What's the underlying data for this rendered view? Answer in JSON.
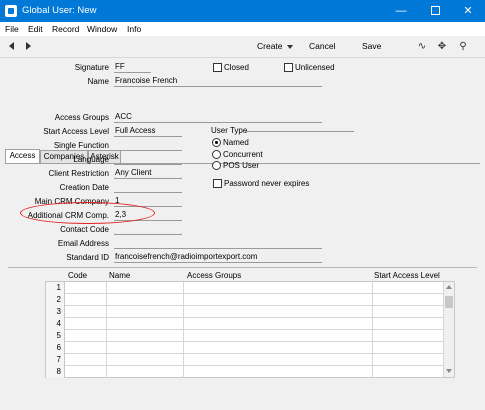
{
  "window": {
    "title": "Global User: New"
  },
  "menu": [
    "File",
    "Edit",
    "Record",
    "Window",
    "Info"
  ],
  "toolbar": {
    "create": "Create",
    "cancel": "Cancel",
    "save": "Save"
  },
  "header": {
    "signature_label": "Signature",
    "signature_value": "FF",
    "name_label": "Name",
    "name_value": "Francoise French",
    "closed_label": "Closed",
    "closed_checked": false,
    "unlicensed_label": "Unlicensed",
    "unlicensed_checked": false
  },
  "tabs": [
    "Access",
    "Companies",
    "Asterisk"
  ],
  "active_tab": "Access",
  "access": {
    "access_groups": {
      "label": "Access Groups",
      "value": "ACC"
    },
    "start_access_level": {
      "label": "Start Access Level",
      "value": "Full Access"
    },
    "single_function": {
      "label": "Single Function",
      "value": ""
    },
    "language": {
      "label": "Language",
      "value": ""
    },
    "client_restriction": {
      "label": "Client Restriction",
      "value": "Any Client"
    },
    "creation_date": {
      "label": "Creation Date",
      "value": ""
    },
    "main_crm_company": {
      "label": "Main CRM Company",
      "value": "1"
    },
    "additional_crm_comp": {
      "label": "Additional CRM Comp.",
      "value": "2,3"
    },
    "contact_code": {
      "label": "Contact Code",
      "value": ""
    },
    "email_address": {
      "label": "Email Address",
      "value": ""
    },
    "standard_id": {
      "label": "Standard ID",
      "value": "francoisefrench@radioimportexport.com"
    }
  },
  "user_type": {
    "title": "User Type",
    "options": [
      "Named",
      "Concurrent",
      "POS User"
    ],
    "selected": "Named",
    "password_never_expires_label": "Password never expires",
    "password_never_expires_checked": false
  },
  "grid": {
    "columns": [
      "Code",
      "Name",
      "Access Groups",
      "Start Access Level"
    ],
    "row_numbers": [
      "1",
      "2",
      "3",
      "4",
      "5",
      "6",
      "7",
      "8"
    ]
  }
}
